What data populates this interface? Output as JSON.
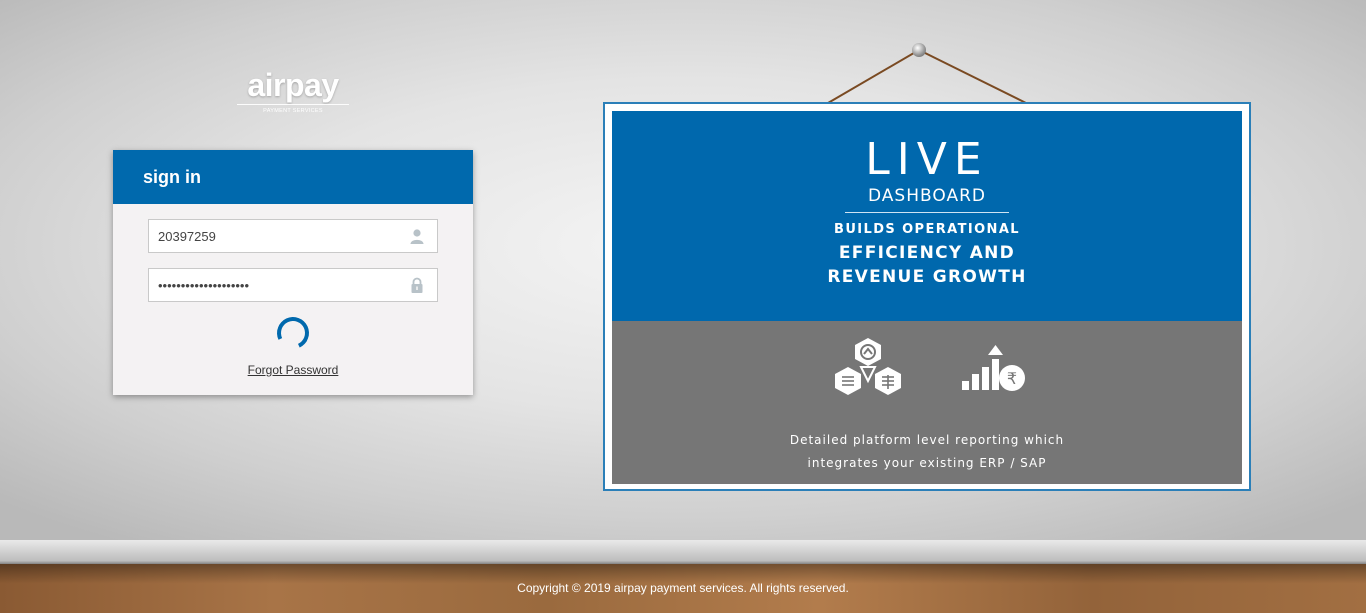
{
  "brand": {
    "logo_text": "airpay",
    "logo_subtext": "PAYMENT SERVICES"
  },
  "signin": {
    "title": "sign in",
    "username": {
      "value": "20397259",
      "icon": "user-icon"
    },
    "password": {
      "value": "••••••••••••••••••••",
      "icon": "lock-icon"
    },
    "loading_indicator": "spinner",
    "forgot_link": "Forgot Password"
  },
  "banner": {
    "headline": "LIVE",
    "subheadline": "DASHBOARD",
    "tagline_1": "BUILDS OPERATIONAL",
    "tagline_2": "EFFICIENCY AND",
    "tagline_3": "REVENUE GROWTH",
    "icons": [
      "hexagon-cluster-icon",
      "growth-rupee-icon"
    ],
    "description_1": "Detailed platform level reporting which",
    "description_2": "integrates your existing ERP / SAP",
    "colors": {
      "top": "#0068ad",
      "bottom": "#767676"
    }
  },
  "footer": {
    "copyright": "Copyright © 2019 airpay payment services. All rights reserved."
  },
  "colors": {
    "accent": "#0069ad",
    "card_background": "#f4f2f3"
  }
}
